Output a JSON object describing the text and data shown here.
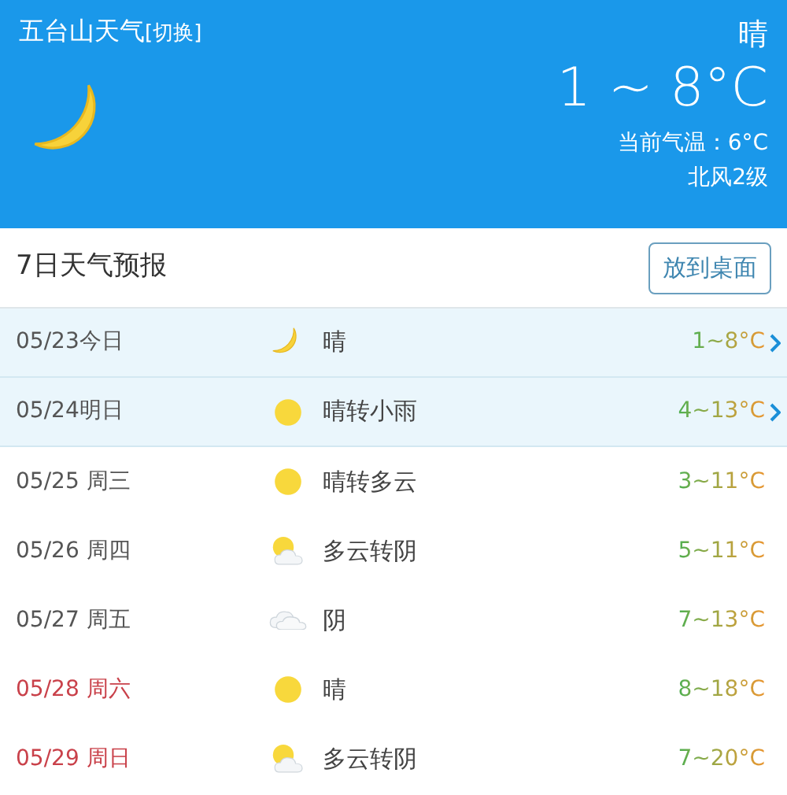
{
  "header": {
    "city": "五台山天气",
    "switch_link": "[切换]",
    "kind": "moon",
    "condition": "晴",
    "temp_range": "1 ~ 8°C",
    "current_temp": "当前气温：6°C",
    "wind": "北风2级"
  },
  "forecast": {
    "title": "7日天气预报",
    "button": "放到桌面",
    "rows": [
      {
        "date": "05/23今日",
        "kind": "moon",
        "condition": "晴",
        "temp": "1~8°C",
        "highlighted": true,
        "weekend": false
      },
      {
        "date": "05/24明日",
        "kind": "sun",
        "condition": "晴转小雨",
        "temp": "4~13°C",
        "highlighted": true,
        "weekend": false
      },
      {
        "date": "05/25 周三",
        "kind": "sun",
        "condition": "晴转多云",
        "temp": "3~11°C",
        "highlighted": false,
        "weekend": false
      },
      {
        "date": "05/26 周四",
        "kind": "partly-cloudy",
        "condition": "多云转阴",
        "temp": "5~11°C",
        "highlighted": false,
        "weekend": false
      },
      {
        "date": "05/27 周五",
        "kind": "cloudy",
        "condition": "阴",
        "temp": "7~13°C",
        "highlighted": false,
        "weekend": false
      },
      {
        "date": "05/28 周六",
        "kind": "sun",
        "condition": "晴",
        "temp": "8~18°C",
        "highlighted": false,
        "weekend": true
      },
      {
        "date": "05/29 周日",
        "kind": "partly-cloudy",
        "condition": "多云转阴",
        "temp": "7~20°C",
        "highlighted": false,
        "weekend": true
      }
    ]
  }
}
